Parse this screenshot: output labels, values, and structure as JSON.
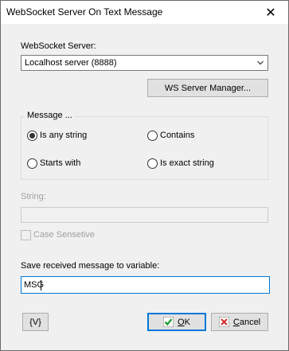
{
  "window": {
    "title": "WebSocket Server On Text Message",
    "close_glyph": "✕"
  },
  "server": {
    "label": "WebSocket Server:",
    "selected": "Localhost server (8888)",
    "manager_button": "WS Server Manager..."
  },
  "message_group": {
    "legend": "Message ...",
    "options": [
      {
        "label": "Is any string",
        "checked": true
      },
      {
        "label": "Contains",
        "checked": false
      },
      {
        "label": "Starts with",
        "checked": false
      },
      {
        "label": "Is exact string",
        "checked": false
      }
    ]
  },
  "string_field": {
    "label": "String:",
    "value": "",
    "enabled": false
  },
  "case_sensitive": {
    "label": "Case Sensetive",
    "checked": false,
    "enabled": false
  },
  "save_variable": {
    "label": "Save received message to variable:",
    "value": "MSG"
  },
  "buttons": {
    "variables": "{V}",
    "ok_accel": "O",
    "ok_rest": "K",
    "cancel_accel": "C",
    "cancel_rest": "ancel"
  },
  "colors": {
    "accent": "#0078d7",
    "ok_check": "#1a9c2f",
    "cancel_x": "#d42a2a"
  },
  "icons": {
    "ok": "green-check-icon",
    "cancel": "red-x-icon",
    "dropdown": "chevron-down-icon",
    "close": "close-icon"
  }
}
